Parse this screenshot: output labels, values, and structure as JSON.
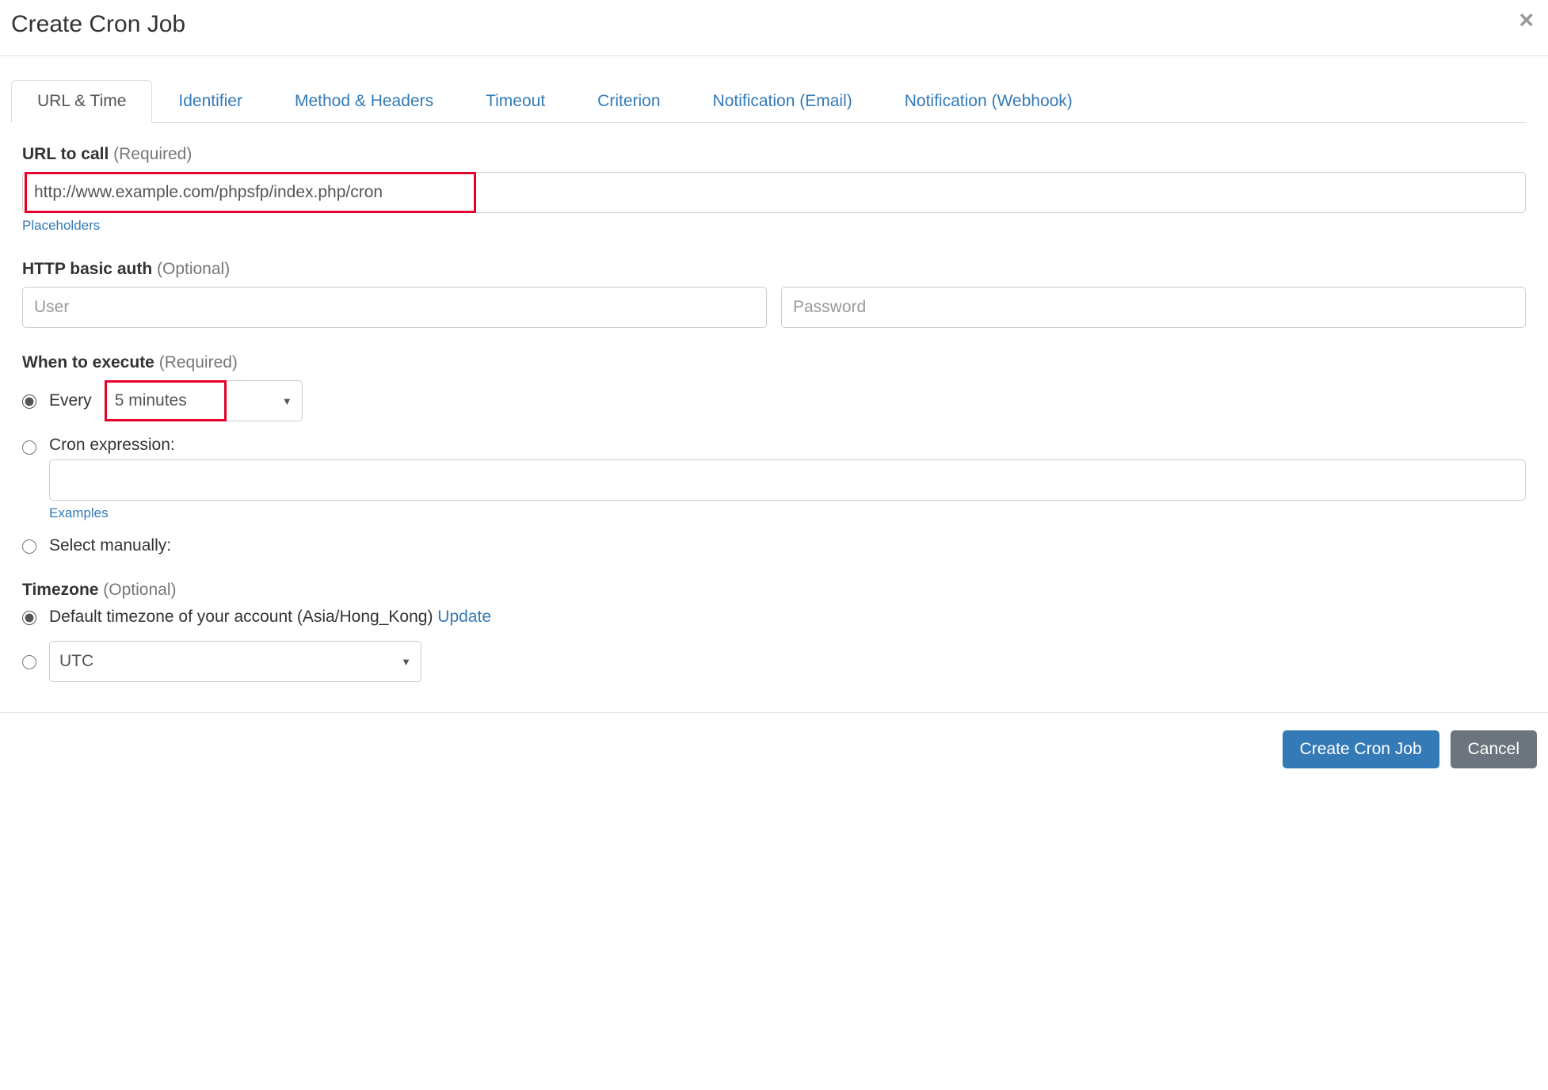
{
  "header": {
    "title": "Create Cron Job"
  },
  "tabs": [
    "URL & Time",
    "Identifier",
    "Method & Headers",
    "Timeout",
    "Criterion",
    "Notification (Email)",
    "Notification (Webhook)"
  ],
  "url_section": {
    "label_bold": "URL to call",
    "label_hint": " (Required)",
    "value": "http://www.example.com/phpsfp/index.php/cron",
    "placeholders_link": "Placeholders"
  },
  "auth_section": {
    "label_bold": "HTTP basic auth",
    "label_hint": " (Optional)",
    "user_placeholder": "User",
    "password_placeholder": "Password"
  },
  "when_section": {
    "label_bold": "When to execute",
    "label_hint": " (Required)",
    "every_label": "Every",
    "interval_value": "5 minutes",
    "cron_label": "Cron expression:",
    "cron_value": "",
    "examples_link": "Examples",
    "manual_label": "Select manually:"
  },
  "tz_section": {
    "label_bold": "Timezone",
    "label_hint": " (Optional)",
    "default_label": "Default timezone of your account (Asia/Hong_Kong) ",
    "update_link": "Update",
    "tz_value": "UTC"
  },
  "footer": {
    "primary": "Create Cron Job",
    "cancel": "Cancel"
  }
}
